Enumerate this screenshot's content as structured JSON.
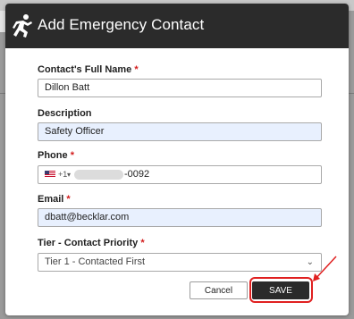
{
  "modal": {
    "title": "Add Emergency Contact"
  },
  "form": {
    "full_name": {
      "label": "Contact's Full Name",
      "required_mark": "*",
      "value": "Dillon Batt"
    },
    "description": {
      "label": "Description",
      "value": "Safety Officer"
    },
    "phone": {
      "label": "Phone",
      "required_mark": "*",
      "country_code": "+1",
      "country_flag": "us-flag-icon",
      "value_suffix": "-0092"
    },
    "email": {
      "label": "Email",
      "required_mark": "*",
      "value": "dbatt@becklar.com"
    },
    "tier": {
      "label": "Tier - Contact Priority",
      "required_mark": "*",
      "selected": "Tier 1 - Contacted First"
    }
  },
  "actions": {
    "cancel_label": "Cancel",
    "save_label": "SAVE"
  },
  "annotation": {
    "highlight_color": "#e02020",
    "target": "save-button"
  },
  "colors": {
    "header_bg": "#2b2b2b",
    "autofill_bg": "#e8f0fe",
    "required": "#d31d1d"
  }
}
